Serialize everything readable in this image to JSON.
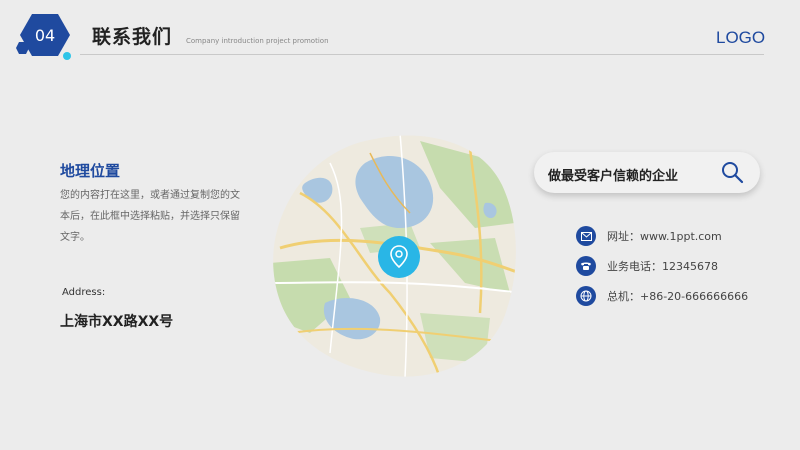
{
  "header": {
    "number": "04",
    "title": "联系我们",
    "subtitle": "Company introduction project promotion",
    "logo": "LOGO"
  },
  "location": {
    "heading": "地理位置",
    "description": "您的内容打在这里，或者通过复制您的文本后，在此框中选择粘贴，并选择只保留文字。",
    "address_label": "Address:",
    "address_value": "上海市XX路XX号"
  },
  "search": {
    "text": "做最受客户信赖的企业",
    "icon": "search-icon"
  },
  "contacts": [
    {
      "icon": "email-icon",
      "text": "网址：www.1ppt.com"
    },
    {
      "icon": "phone-icon",
      "text": "业务电话：12345678"
    },
    {
      "icon": "globe-icon",
      "text": "总机：+86-20-666666666"
    }
  ],
  "colors": {
    "primary": "#1f4a9f",
    "accent": "#2ec4e8",
    "background": "#ececec"
  }
}
